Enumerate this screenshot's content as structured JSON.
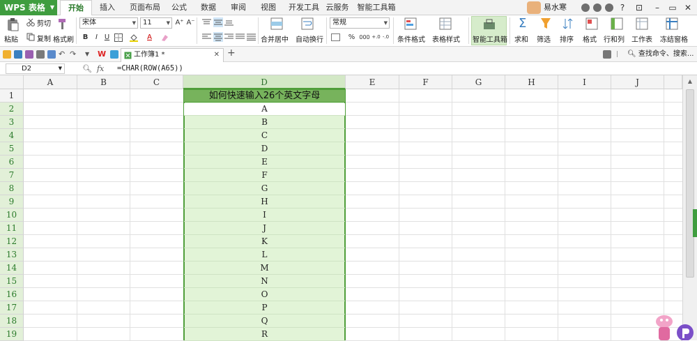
{
  "app": {
    "menu_label": "WPS 表格",
    "accent": "#3f9d3f"
  },
  "ribbon_tabs": [
    "开始",
    "插入",
    "页面布局",
    "公式",
    "数据",
    "审阅",
    "视图",
    "开发工具",
    "云服务",
    "智能工具箱"
  ],
  "user": {
    "name": "易水寒",
    "help": "?"
  },
  "ribbon": {
    "paste": "粘贴",
    "cut": "剪切",
    "copy": "复制",
    "format_painter": "格式刷",
    "font_name": "宋体",
    "font_size": "11",
    "bold": "B",
    "italic": "I",
    "underline": "U",
    "font_color_glyph": "A",
    "grow_font": "A⁺",
    "shrink_font": "A⁻",
    "merge_center": "合并居中",
    "wrap_text": "自动换行",
    "number_format": "常规",
    "percent": "%",
    "thousands": "000",
    "dec_inc": "+.0",
    "dec_dec": "-.0",
    "conditional_format": "条件格式",
    "table_style": "表格样式",
    "smart_toolbox": "智能工具箱",
    "sum": "求和",
    "filter": "筛选",
    "sort": "排序",
    "format": "格式",
    "rows_cols": "行和列",
    "worksheet": "工作表",
    "freeze": "冻结窗格"
  },
  "doc_tab": "工作簿1 *",
  "search": {
    "placeholder": "查找命令、搜索..."
  },
  "formula_bar": {
    "cell_ref": "D2",
    "fx": "fx",
    "formula": "=CHAR(ROW(A65))"
  },
  "sheet": {
    "columns": [
      "A",
      "B",
      "C",
      "D",
      "E",
      "F",
      "G",
      "H",
      "I",
      "J"
    ],
    "selected_column": "D",
    "rows": [
      "1",
      "2",
      "3",
      "4",
      "5",
      "6",
      "7",
      "8",
      "9",
      "10",
      "11",
      "12",
      "13",
      "14",
      "15",
      "16",
      "17",
      "18",
      "19"
    ],
    "header_cell": "如何快速输入26个英文字母",
    "d_values": [
      "A",
      "B",
      "C",
      "D",
      "E",
      "F",
      "G",
      "H",
      "I",
      "J",
      "K",
      "L",
      "M",
      "N",
      "O",
      "P",
      "Q",
      "R"
    ],
    "selection_fill": "#e2f4d7",
    "header_fill": "#77b35c",
    "selection_border": "#4f9e3a"
  }
}
